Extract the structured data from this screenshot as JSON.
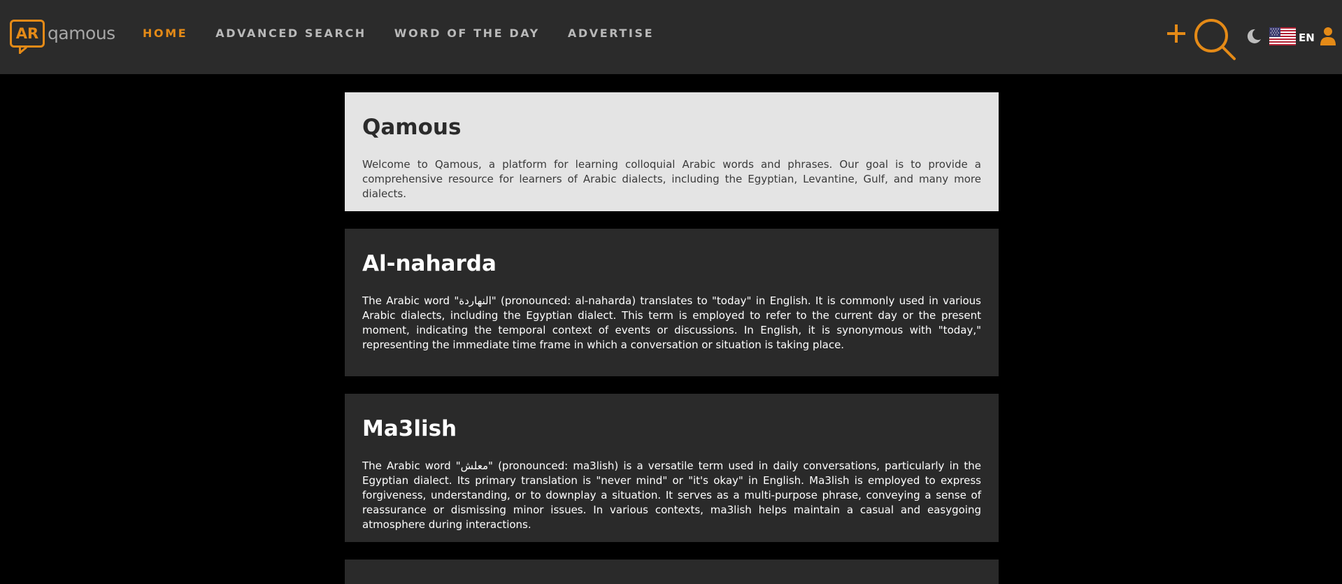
{
  "header": {
    "logo_badge": "AR",
    "logo_text": "qamous",
    "nav": [
      {
        "label": "HOME",
        "active": true
      },
      {
        "label": "ADVANCED SEARCH",
        "active": false
      },
      {
        "label": "WORD OF THE DAY",
        "active": false
      },
      {
        "label": "ADVERTISE",
        "active": false
      }
    ],
    "language": "EN",
    "icons": [
      "plus-icon",
      "search-icon",
      "moon-icon",
      "us-flag-icon",
      "user-icon"
    ]
  },
  "colors": {
    "accent": "#e48a17",
    "header_bg": "#2b2b2b",
    "page_bg": "#000000",
    "card_light": "#e4e4e4",
    "card_dark": "#2a2a2a"
  },
  "cards": [
    {
      "title": "Qamous",
      "body": "Welcome to Qamous, a platform for learning colloquial Arabic words and phrases. Our goal is to provide a comprehensive resource for learners of Arabic dialects, including the Egyptian, Levantine, Gulf, and many more dialects."
    },
    {
      "title": "Al-naharda",
      "body": "The Arabic word \"النهاردة\" (pronounced: al-naharda) translates to \"today\" in English. It is commonly used in various Arabic dialects, including the Egyptian dialect. This term is employed to refer to the current day or the present moment, indicating the temporal context of events or discussions. In English, it is synonymous with \"today,\" representing the immediate time frame in which a conversation or situation is taking place."
    },
    {
      "title": "Ma3lish",
      "body": "The Arabic word \"معلش\" (pronounced: ma3lish) is a versatile term used in daily conversations, particularly in the Egyptian dialect. Its primary translation is \"never mind\" or \"it's okay\" in English. Ma3lish is employed to express forgiveness, understanding, or to downplay a situation. It serves as a multi-purpose phrase, conveying a sense of reassurance or dismissing minor issues. In various contexts, ma3lish helps maintain a casual and easygoing atmosphere during interactions."
    }
  ]
}
